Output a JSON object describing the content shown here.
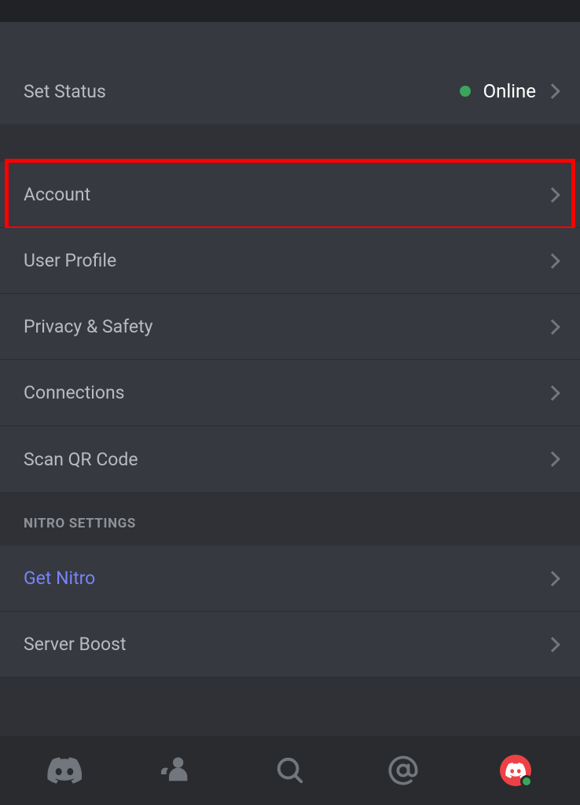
{
  "status_row": {
    "label": "Set Status",
    "value": "Online",
    "dot_color": "#3ba55d"
  },
  "user_settings": [
    {
      "label": "Account",
      "highlighted": true
    },
    {
      "label": "User Profile"
    },
    {
      "label": "Privacy & Safety"
    },
    {
      "label": "Connections"
    },
    {
      "label": "Scan QR Code"
    }
  ],
  "nitro_header": "NITRO SETTINGS",
  "nitro_settings": [
    {
      "label": "Get Nitro",
      "accent": true
    },
    {
      "label": "Server Boost"
    }
  ],
  "icons": {
    "home": "discord-logo-icon",
    "friends": "friends-icon",
    "search": "search-icon",
    "mentions": "mentions-icon",
    "profile": "profile-avatar"
  }
}
